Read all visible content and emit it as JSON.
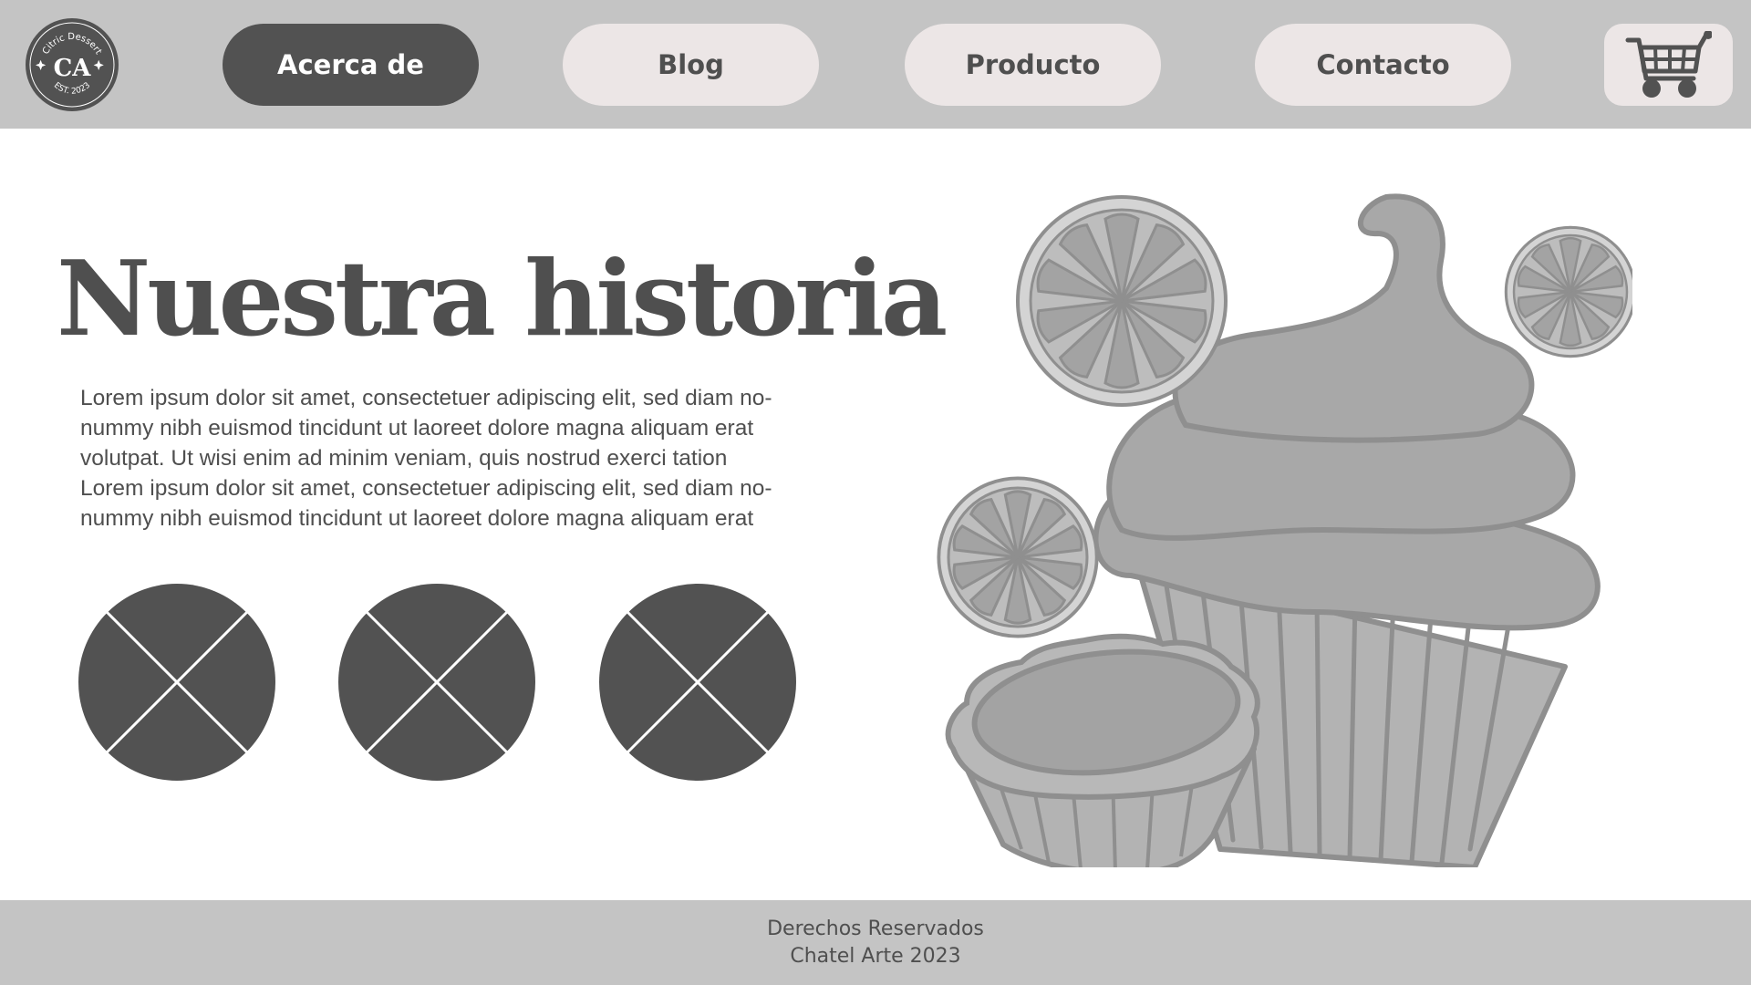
{
  "header": {
    "logo": {
      "top_text": "Citric Dessert",
      "monogram": "CA",
      "bottom_text": "EST. 2023",
      "icon": "logo-badge"
    },
    "nav": [
      {
        "label": "Acerca de",
        "active": true
      },
      {
        "label": "Blog",
        "active": false
      },
      {
        "label": "Producto",
        "active": false
      },
      {
        "label": "Contacto",
        "active": false
      }
    ],
    "cart_icon": "shopping-cart-icon"
  },
  "main": {
    "title": "Nuestra historia",
    "paragraph_lines": [
      "Lorem ipsum dolor sit amet, consectetuer adipiscing elit, sed diam no-",
      "nummy nibh euismod tincidunt ut laoreet dolore magna aliquam erat",
      "volutpat. Ut wisi enim ad minim veniam, quis nostrud exerci tation",
      "Lorem ipsum dolor sit amet, consectetuer adipiscing elit, sed diam no-",
      "nummy nibh euismod tincidunt ut laoreet dolore magna aliquam erat"
    ],
    "image_placeholders": [
      "image-placeholder-icon",
      "image-placeholder-icon",
      "image-placeholder-icon"
    ],
    "illustration": [
      "cupcake",
      "tart",
      "lemon-slice",
      "lemon-slice",
      "lemon-slice"
    ]
  },
  "footer": {
    "line1": "Derechos Reservados",
    "line2": "Chatel Arte 2023"
  },
  "colors": {
    "header_bg": "#c4c4c4",
    "nav_active_bg": "#525252",
    "nav_bg": "#ece6e6",
    "text": "#4f4f4f",
    "placeholder": "#525252"
  }
}
